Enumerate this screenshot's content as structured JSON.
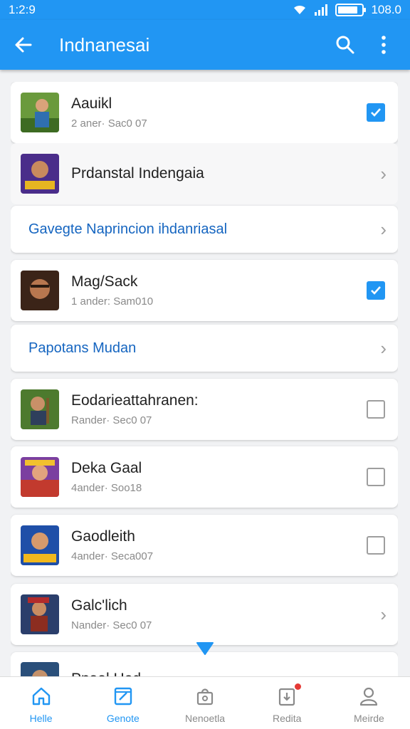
{
  "status_bar": {
    "time": "1:2:9",
    "battery_percent": "108.0",
    "battery_level": 0.85
  },
  "app_bar": {
    "title": "Indnanesai",
    "icons": [
      "back-arrow-icon",
      "search-icon",
      "more-vert-icon"
    ]
  },
  "list": [
    {
      "kind": "item",
      "title": "Aauikl",
      "subtitle": "2 aner· Sac0 07",
      "control": "checked"
    },
    {
      "kind": "item",
      "title": "Prdanstal Indengaia",
      "subtitle": "",
      "control": "chevron"
    },
    {
      "kind": "link",
      "title": "Gavegte Naprincion ihdanriasal",
      "control": "chevron"
    },
    {
      "kind": "item",
      "title": "Mag/Sack",
      "subtitle": "1 ander: Sam010",
      "control": "checked"
    },
    {
      "kind": "link",
      "title": "Papotans Mudan",
      "control": "chevron"
    },
    {
      "kind": "item",
      "title": "Eodarieattahranen:",
      "subtitle": "Rander· Sec0 07",
      "control": "unchecked"
    },
    {
      "kind": "item",
      "title": "Deka Gaal",
      "subtitle": "4ander· Soo18",
      "control": "unchecked"
    },
    {
      "kind": "item",
      "title": "Gaodleith",
      "subtitle": "4ander· Seca007",
      "control": "unchecked"
    },
    {
      "kind": "item",
      "title": "Galc'lich",
      "subtitle": "Nander· Sec0 07",
      "control": "chevron"
    },
    {
      "kind": "item",
      "title": "Ppaal Hed",
      "subtitle": "",
      "control": "none"
    }
  ],
  "bottom_nav": [
    {
      "label": "Helle",
      "icon": "home-icon",
      "active": false
    },
    {
      "label": "Genote",
      "icon": "edit-calendar-icon",
      "active": true
    },
    {
      "label": "Nenoetla",
      "icon": "gift-icon",
      "active": false
    },
    {
      "label": "Redita",
      "icon": "inbox-icon",
      "active": false,
      "badge": true
    },
    {
      "label": "Meirde",
      "icon": "profile-icon",
      "active": false
    }
  ],
  "colors": {
    "primary": "#2196f3",
    "link": "#1565c0",
    "badge": "#e53935"
  }
}
